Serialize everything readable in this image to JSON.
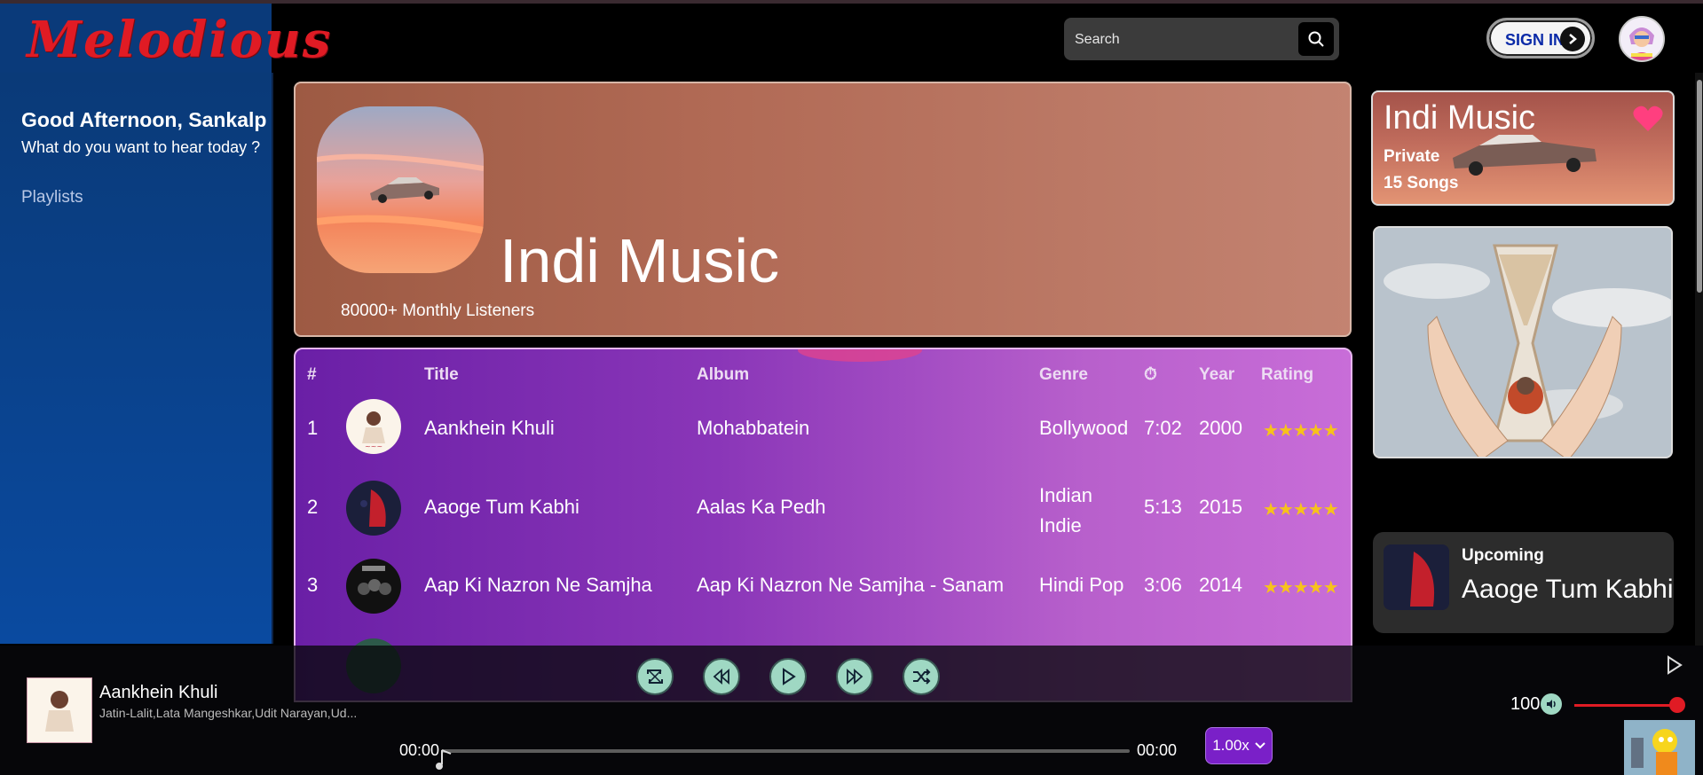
{
  "app": {
    "logo": "Melodious"
  },
  "search": {
    "placeholder": "Search"
  },
  "header": {
    "signin_label": "SIGN IN"
  },
  "sidebar": {
    "greeting": "Good Afternoon, Sankalp",
    "subtitle": "What do you want to hear today ?",
    "items": [
      {
        "label": "Playlists"
      }
    ]
  },
  "banner": {
    "title": "Indi Music",
    "listeners": "80000+ Monthly Listeners"
  },
  "table": {
    "headers": {
      "num": "#",
      "title": "Title",
      "album": "Album",
      "genre": "Genre",
      "duration_icon": "⏱",
      "year": "Year",
      "rating": "Rating"
    },
    "rows": [
      {
        "num": "1",
        "title": "Aankhein Khuli",
        "album": "Mohabbatein",
        "genre": "Bollywood",
        "duration": "7:02",
        "year": "2000",
        "rating": "★★★★★",
        "stars": 5
      },
      {
        "num": "2",
        "title": "Aaoge Tum Kabhi",
        "album": "Aalas Ka Pedh",
        "genre_line1": "Indian",
        "genre_line2": "Indie",
        "duration": "5:13",
        "year": "2015",
        "rating": "★★★★★",
        "stars": 5
      },
      {
        "num": "3",
        "title": "Aap Ki Nazron Ne Samjha",
        "album": "Aap Ki Nazron Ne Samjha - Sanam",
        "genre": "Hindi Pop",
        "duration": "3:06",
        "year": "2014",
        "rating": "★★★★★",
        "stars": 5
      }
    ]
  },
  "playlist_card": {
    "title": "Indi Music",
    "visibility": "Private",
    "count": "15 Songs"
  },
  "upcoming": {
    "label": "Upcoming",
    "title": "Aaoge Tum Kabhi"
  },
  "player": {
    "now_playing_title": "Aankhein Khuli",
    "now_playing_artist": "Jatin-Lalit,Lata Mangeshkar,Udit Narayan,Ud...",
    "current_time": "00:00",
    "total_time": "00:00",
    "speed": "1.00x",
    "volume": "100",
    "progress": 0
  },
  "colors": {
    "logo": "#e01b24",
    "sidebar": "#0a3a78",
    "control_accent": "#9fd8c3",
    "stars": "#f7c21b",
    "volume": "#e01b24"
  }
}
